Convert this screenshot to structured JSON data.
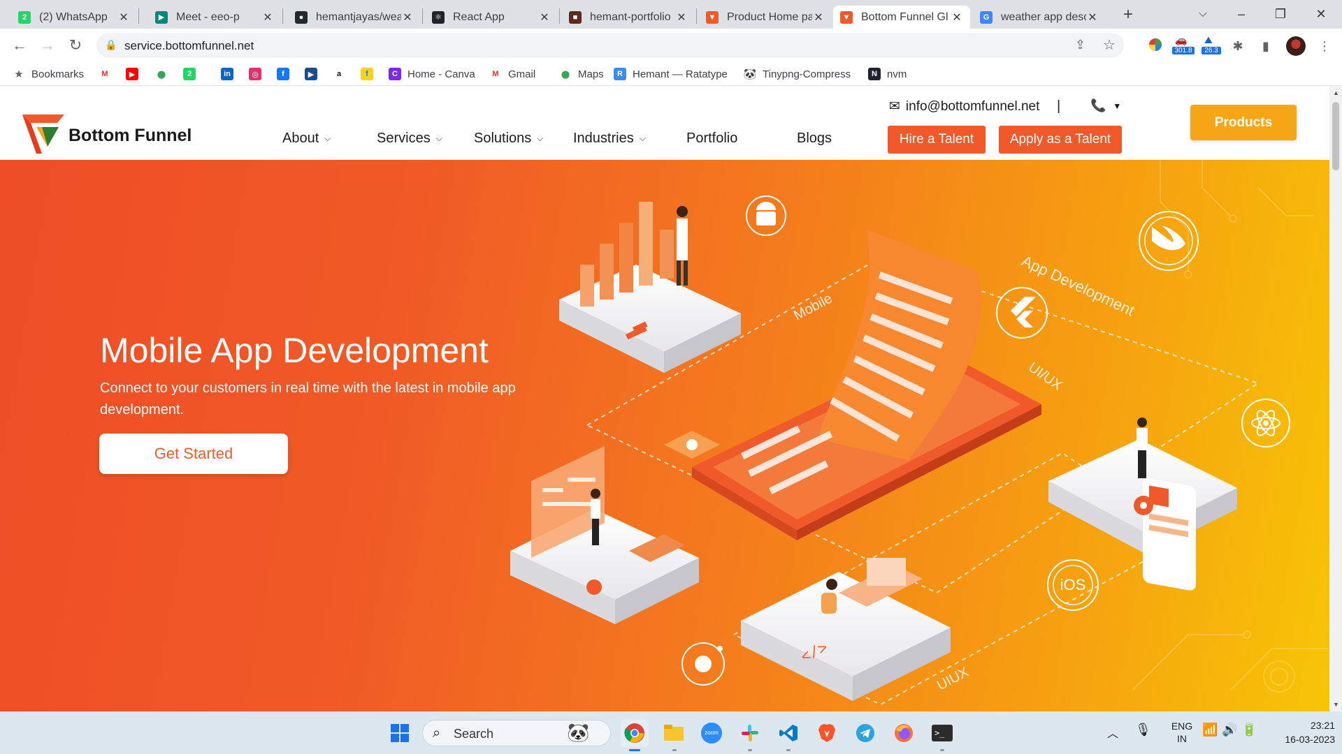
{
  "browser": {
    "tabs": [
      {
        "label": "(2) WhatsApp",
        "icon": "whatsapp-icon",
        "color": "#25d366"
      },
      {
        "label": "Meet - eeo-p",
        "icon": "google-meet-icon",
        "color": "#00897b"
      },
      {
        "label": "hemantjayas/wea",
        "icon": "github-icon",
        "color": "#24292e"
      },
      {
        "label": "React App",
        "icon": "react-icon",
        "color": "#20232a"
      },
      {
        "label": "hemant-portfolio",
        "icon": "portfolio-icon",
        "color": "#5a2a1a"
      },
      {
        "label": "Product Home pa",
        "icon": "bottom-funnel-icon",
        "color": "#f05a2b"
      },
      {
        "label": "Bottom Funnel Gl",
        "icon": "bottom-funnel-icon",
        "color": "#f05a2b",
        "active": true
      },
      {
        "label": "weather app desc",
        "icon": "google-icon",
        "color": "#4285f4"
      }
    ],
    "url": "service.bottomfunnel.net",
    "extension_badges": [
      "301.8",
      "26.3"
    ]
  },
  "bookmarks": {
    "items": [
      {
        "label": "Bookmarks",
        "icon": "star-icon"
      },
      {
        "label": "",
        "icon": "gmail-icon"
      },
      {
        "label": "",
        "icon": "youtube-icon"
      },
      {
        "label": "",
        "icon": "maps-icon"
      },
      {
        "label": "",
        "icon": "whatsapp-icon"
      },
      {
        "label": "",
        "icon": "linkedin-icon"
      },
      {
        "label": "",
        "icon": "instagram-icon"
      },
      {
        "label": "",
        "icon": "facebook-icon"
      },
      {
        "label": "",
        "icon": "play-icon"
      },
      {
        "label": "",
        "icon": "amazon-icon"
      },
      {
        "label": "",
        "icon": "flipkart-icon"
      },
      {
        "label": "Home - Canva",
        "icon": "canva-icon"
      },
      {
        "label": "Gmail",
        "icon": "gmail-icon"
      },
      {
        "label": "Maps",
        "icon": "maps-icon"
      },
      {
        "label": "Hemant — Ratatype",
        "icon": "ratatype-icon"
      },
      {
        "label": "Tinypng-Compress",
        "icon": "panda-icon"
      },
      {
        "label": "nvm",
        "icon": "nvm-icon"
      }
    ]
  },
  "site": {
    "brand": "Bottom Funnel",
    "email": "info@bottomfunnel.net",
    "divider": "|",
    "nav": [
      {
        "label": "About",
        "dropdown": true
      },
      {
        "label": "Services",
        "dropdown": true
      },
      {
        "label": "Solutions",
        "dropdown": true
      },
      {
        "label": "Industries",
        "dropdown": true
      },
      {
        "label": "Portfolio",
        "dropdown": false
      },
      {
        "label": "Blogs",
        "dropdown": false
      }
    ],
    "hire_button": "Hire a Talent",
    "apply_button": "Apply as a Talent",
    "products_button": "Products",
    "colors": {
      "accent": "#f05a2b",
      "products": "#f7a716"
    }
  },
  "hero": {
    "title": "Mobile App Development",
    "subtitle": "Connect to your customers in real time with the latest in mobile app development.",
    "cta": "Get Started",
    "illustration_labels": {
      "mobile": "Mobile",
      "app_dev": "App Development",
      "uiux_top": "UI/UX",
      "flutter": "Flutter",
      "uiux_bottom": "UIUX",
      "ios": "iOS"
    }
  },
  "taskbar": {
    "search_placeholder": "Search",
    "lang": "ENG",
    "region": "IN",
    "time": "23:21",
    "date": "16-03-2023"
  }
}
